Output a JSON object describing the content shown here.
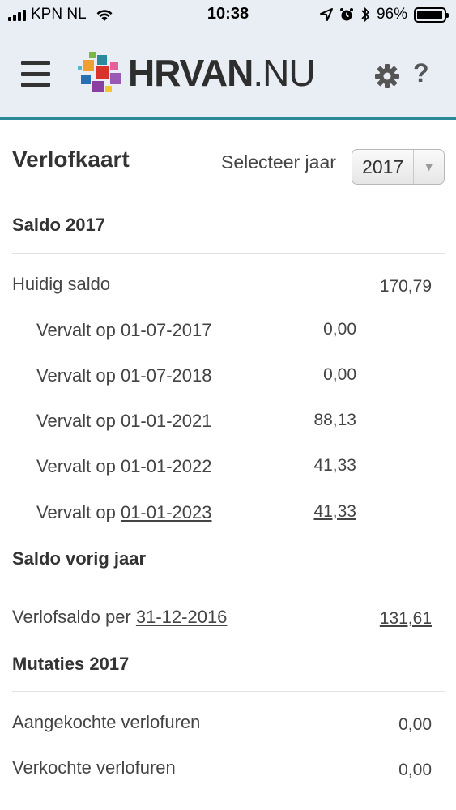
{
  "status_bar": {
    "carrier": "KPN NL",
    "time": "10:38",
    "battery_percent": "96%",
    "battery_level": 0.96
  },
  "header": {
    "logo_bold": "HRVAN",
    "logo_suffix": ".NU",
    "menu_icon": "hamburger-icon",
    "settings_icon": "gear-icon",
    "help_icon": "question-icon",
    "help_glyph": "?"
  },
  "page": {
    "title": "Verlofkaart",
    "year_label": "Selecteer jaar",
    "year_selected": "2017"
  },
  "saldo": {
    "heading": "Saldo 2017",
    "current_label": "Huidig saldo",
    "current_value": "170,79",
    "expiries": [
      {
        "prefix": "Vervalt op ",
        "date": "01-07-2017",
        "value": "0,00"
      },
      {
        "prefix": "Vervalt op ",
        "date": "01-07-2018",
        "value": "0,00"
      },
      {
        "prefix": "Vervalt op ",
        "date": "01-01-2021",
        "value": "88,13"
      },
      {
        "prefix": "Vervalt op ",
        "date": "01-01-2022",
        "value": "41,33"
      },
      {
        "prefix": "Vervalt op ",
        "date": "01-01-2023",
        "value": "41,33"
      }
    ]
  },
  "previous": {
    "heading": "Saldo vorig jaar",
    "label_prefix": "Verlofsaldo per ",
    "date": "31-12-2016",
    "value": "131,61"
  },
  "mutations": {
    "heading": "Mutaties 2017",
    "rows": [
      {
        "label": "Aangekochte verlofuren",
        "value": "0,00"
      },
      {
        "label": "Verkochte verlofuren",
        "value": "0,00"
      }
    ]
  },
  "colors": {
    "header_bg": "#e8eef4",
    "accent": "#2b8a9a"
  }
}
